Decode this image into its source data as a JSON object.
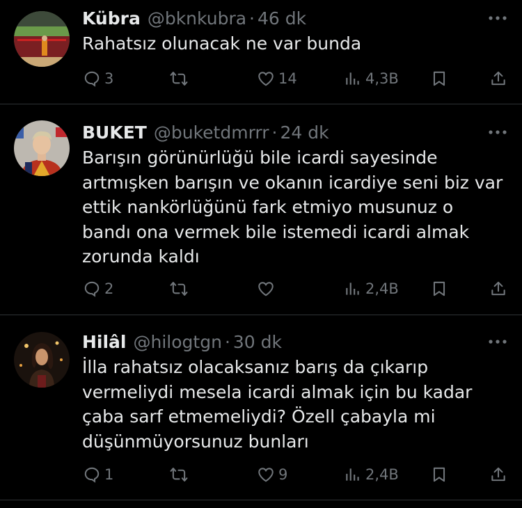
{
  "tweets": [
    {
      "name": "Kübra",
      "handle": "@bknkubra",
      "separator": "·",
      "time": "46 dk",
      "text": "Rahatsız olunacak ne var bunda",
      "replies": "3",
      "retweets": "",
      "likes": "14",
      "views": "4,3B"
    },
    {
      "name": "BUKET",
      "handle": "@buketdmrrr",
      "separator": "·",
      "time": "24 dk",
      "text": "Barışın görünürlüğü bile icardi sayesinde\nartmışken barışın ve okanın icardiye seni biz var\nettik nankörlüğünü fark etmiyo musunuz o\nbandı ona vermek bile istemedi icardi almak\nzorunda kaldı",
      "replies": "2",
      "retweets": "",
      "likes": "",
      "views": "2,4B"
    },
    {
      "name": "Hilâl",
      "handle": "@hilogtgn",
      "separator": "·",
      "time": "30 dk",
      "text": "İlla rahatsız olacaksanız barış da çıkarıp\nvermeliydi mesela icardi almak için bu kadar\nçaba sarf etmemeliydi? Özell çabayla mi\ndüşünmüyorsunuz bunları",
      "replies": "1",
      "retweets": "",
      "likes": "9",
      "views": "2,4B"
    }
  ],
  "icons": [
    "reply-icon",
    "retweet-icon",
    "like-icon",
    "views-icon",
    "bookmark-icon",
    "share-icon",
    "more-icon"
  ],
  "colors": {
    "background": "#000000",
    "text": "#e7e9ea",
    "muted": "#71767b",
    "divider": "#2f3336"
  }
}
